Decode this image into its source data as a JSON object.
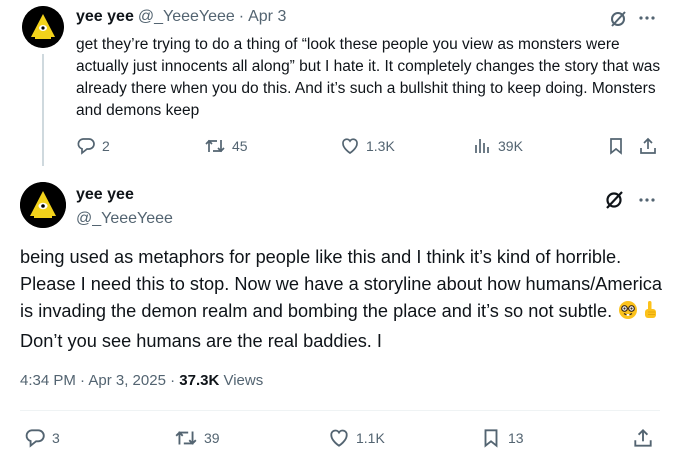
{
  "parent_tweet": {
    "display_name": "yee yee",
    "handle": "@_YeeeYeee",
    "separator": "·",
    "date": "Apr 3",
    "text": "get they’re trying to do a thing of “look these people you view as monsters were actually just innocents all along” but I hate it. It completely changes the story that was already there when you do this. And it’s such a bullshit thing to keep doing. Monsters and demons keep",
    "replies": "2",
    "reposts": "45",
    "likes": "1.3K",
    "views": "39K"
  },
  "main_tweet": {
    "display_name": "yee yee",
    "handle": "@_YeeeYeee",
    "text_before_emoji": "being used as metaphors for people like this and I think it’s kind of horrible.  Please I need this to stop. Now we have a storyline about how humans/America is invading the demon realm and bombing the place and it’s so not subtle. ",
    "text_after_emoji": " Don’t you see humans are the real baddies. I",
    "emojis": [
      "nerd-face-emoji",
      "pointing-up-emoji"
    ],
    "timestamp": "4:34 PM · Apr 3, 2025 · ",
    "views_count": "37.3K",
    "views_label": " Views",
    "replies": "3",
    "reposts": "39",
    "likes": "1.1K",
    "bookmarks": "13"
  },
  "colors": {
    "text": "#0f1419",
    "secondary": "#536471",
    "thread_line": "#cfd9de",
    "avatar_bg": "#000000",
    "avatar_accent": "#f2d21b"
  }
}
